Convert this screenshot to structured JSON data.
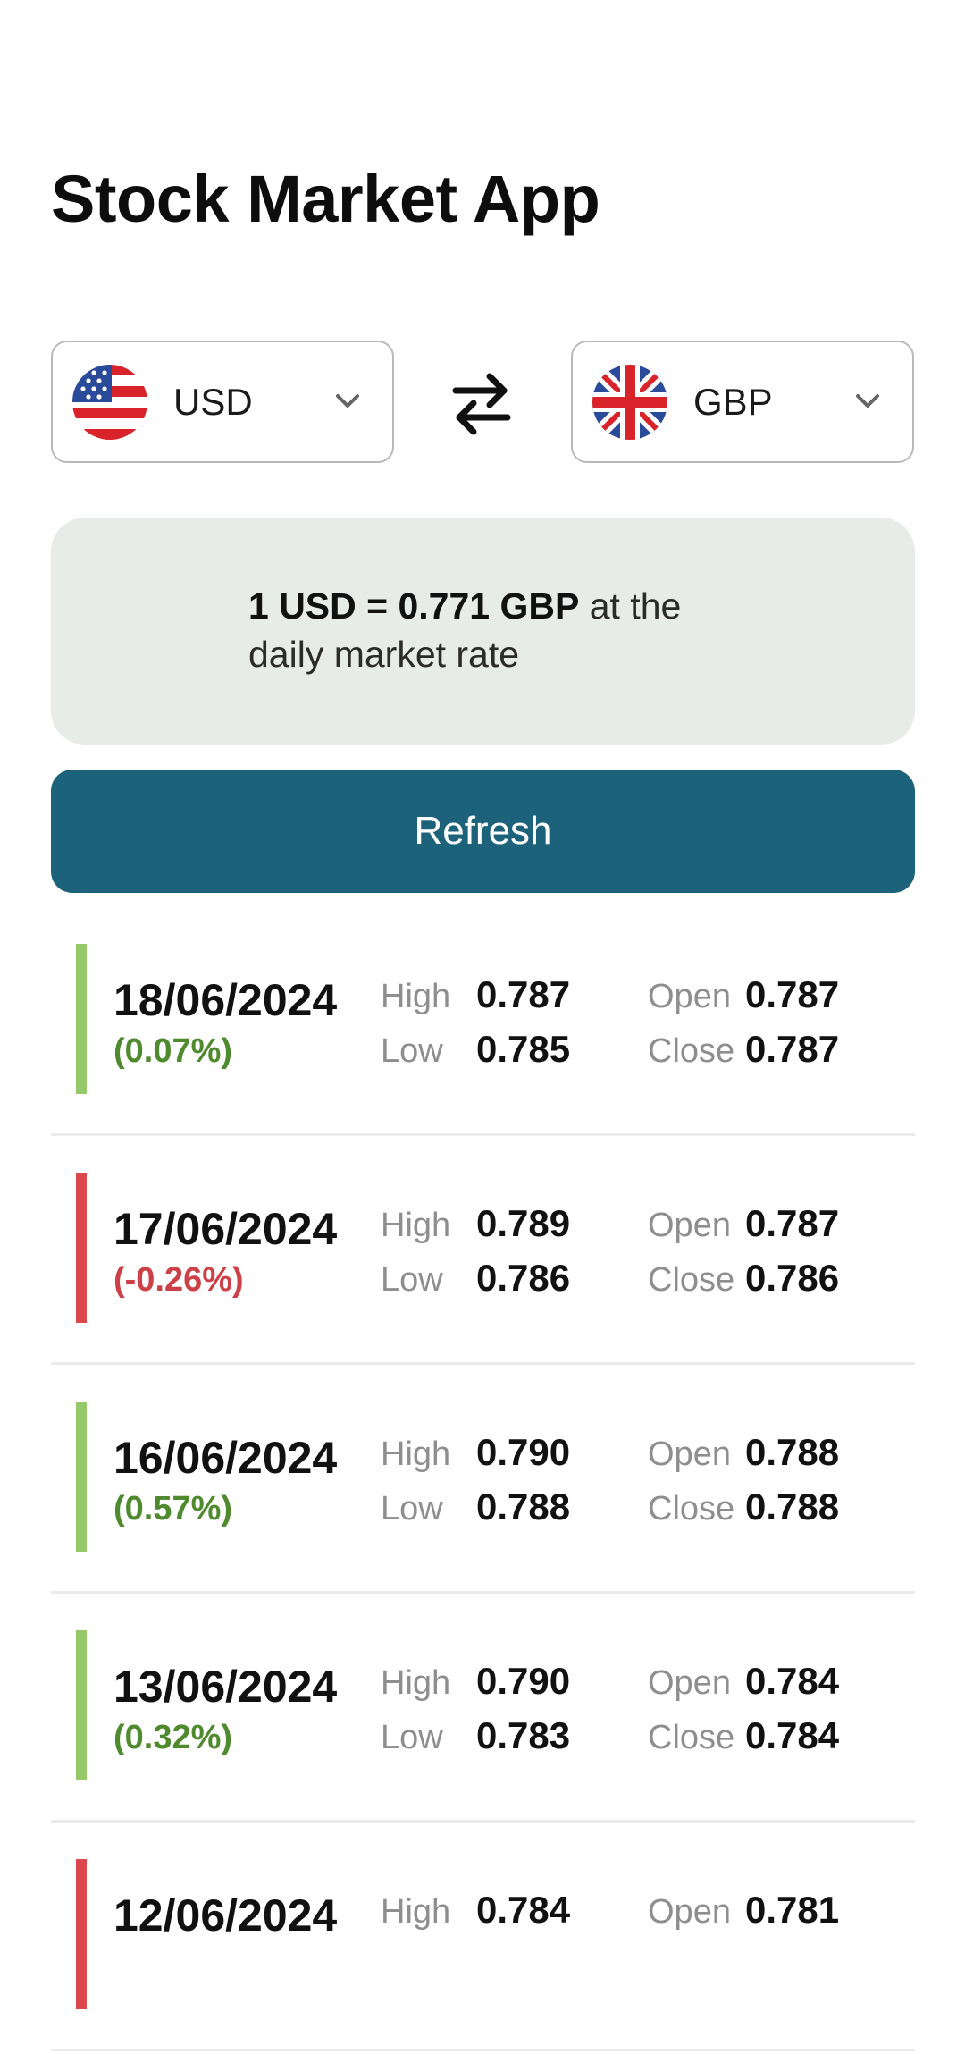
{
  "app": {
    "title": "Stock Market App"
  },
  "converter": {
    "from": {
      "code": "USD",
      "flag_icon": "us-flag-icon"
    },
    "to": {
      "code": "GBP",
      "flag_icon": "uk-flag-icon"
    },
    "swap_icon": "swap-arrows-icon",
    "chevron_icon": "chevron-down-icon"
  },
  "rate": {
    "strong": "1 USD = 0.771 GBP",
    "line1_rest": " at the",
    "line2": "daily market rate"
  },
  "refresh": {
    "label": "Refresh"
  },
  "labels": {
    "high": "High",
    "low": "Low",
    "open": "Open",
    "close": "Close"
  },
  "colors": {
    "accent": "#1c627b",
    "up_bar": "#95c96a",
    "up_text": "#4f8a2e",
    "down_bar": "#dc474d",
    "down_text": "#cd4047",
    "rate_card_bg": "#e8ece8"
  },
  "history": [
    {
      "date": "18/06/2024",
      "change": "(0.07%)",
      "direction": "up",
      "high": "0.787",
      "low": "0.785",
      "open": "0.787",
      "close": "0.787"
    },
    {
      "date": "17/06/2024",
      "change": "(-0.26%)",
      "direction": "down",
      "high": "0.789",
      "low": "0.786",
      "open": "0.787",
      "close": "0.786"
    },
    {
      "date": "16/06/2024",
      "change": "(0.57%)",
      "direction": "up",
      "high": "0.790",
      "low": "0.788",
      "open": "0.788",
      "close": "0.788"
    },
    {
      "date": "13/06/2024",
      "change": "(0.32%)",
      "direction": "up",
      "high": "0.790",
      "low": "0.783",
      "open": "0.784",
      "close": "0.784"
    },
    {
      "date": "12/06/2024",
      "change": "",
      "direction": "down",
      "high": "0.784",
      "low": "",
      "open": "0.781",
      "close": ""
    }
  ]
}
